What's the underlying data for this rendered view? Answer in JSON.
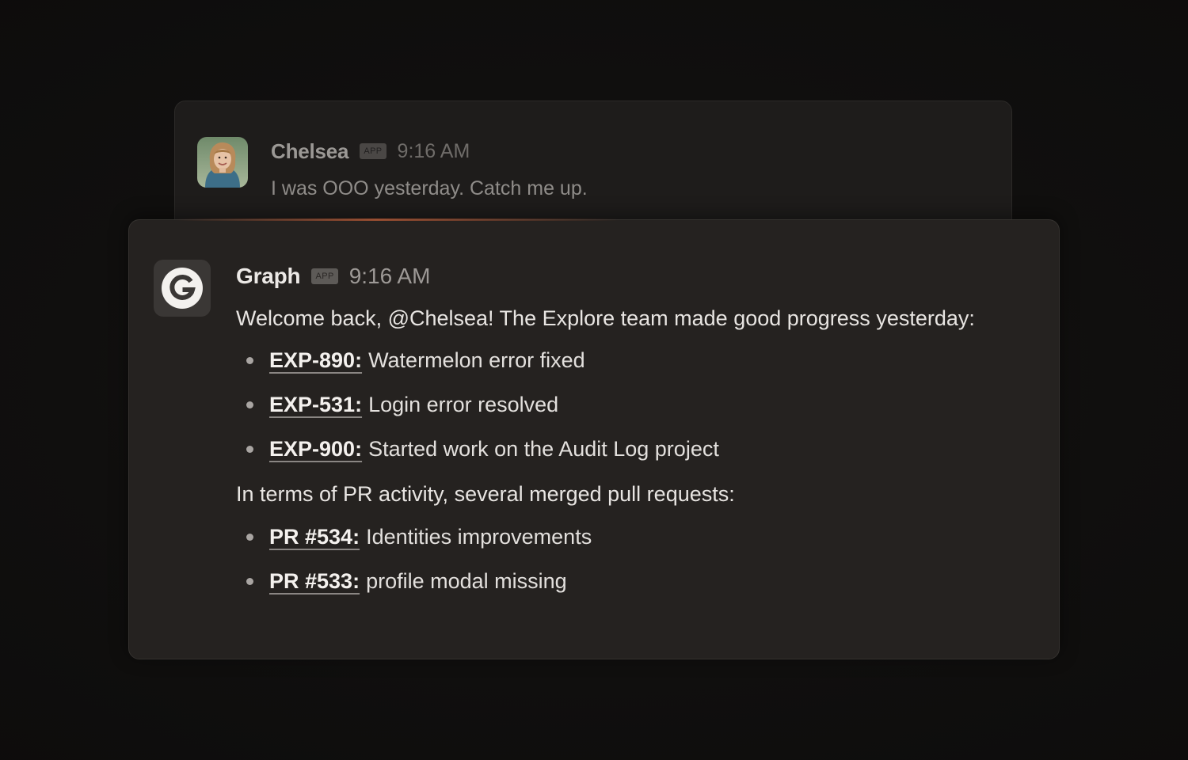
{
  "previous_message": {
    "author": "Chelsea",
    "badge": "APP",
    "time": "9:16 AM",
    "text": "I was OOO yesterday. Catch me up."
  },
  "reply_message": {
    "author": "Graph",
    "badge": "APP",
    "time": "9:16 AM",
    "intro": "Welcome back, @Chelsea! The Explore team made good progress yesterday:",
    "issues": [
      {
        "id": "EXP-890:",
        "text": "Watermelon error fixed"
      },
      {
        "id": "EXP-531:",
        "text": "Login error resolved"
      },
      {
        "id": "EXP-900:",
        "text": "Started work on the Audit Log project"
      }
    ],
    "pr_intro": "In terms of PR activity, several merged pull requests:",
    "pull_requests": [
      {
        "id": "PR #534:",
        "text": "Identities improvements"
      },
      {
        "id": "PR #533:",
        "text": "profile modal missing"
      }
    ]
  },
  "icons": {
    "avatar": "user-avatar",
    "logo": "graph-logo-icon",
    "bullet": "bullet-icon"
  },
  "colors": {
    "background": "#100f0f",
    "card": "#252220",
    "glow": "#f06e3c",
    "text": "#e8e5e2"
  }
}
